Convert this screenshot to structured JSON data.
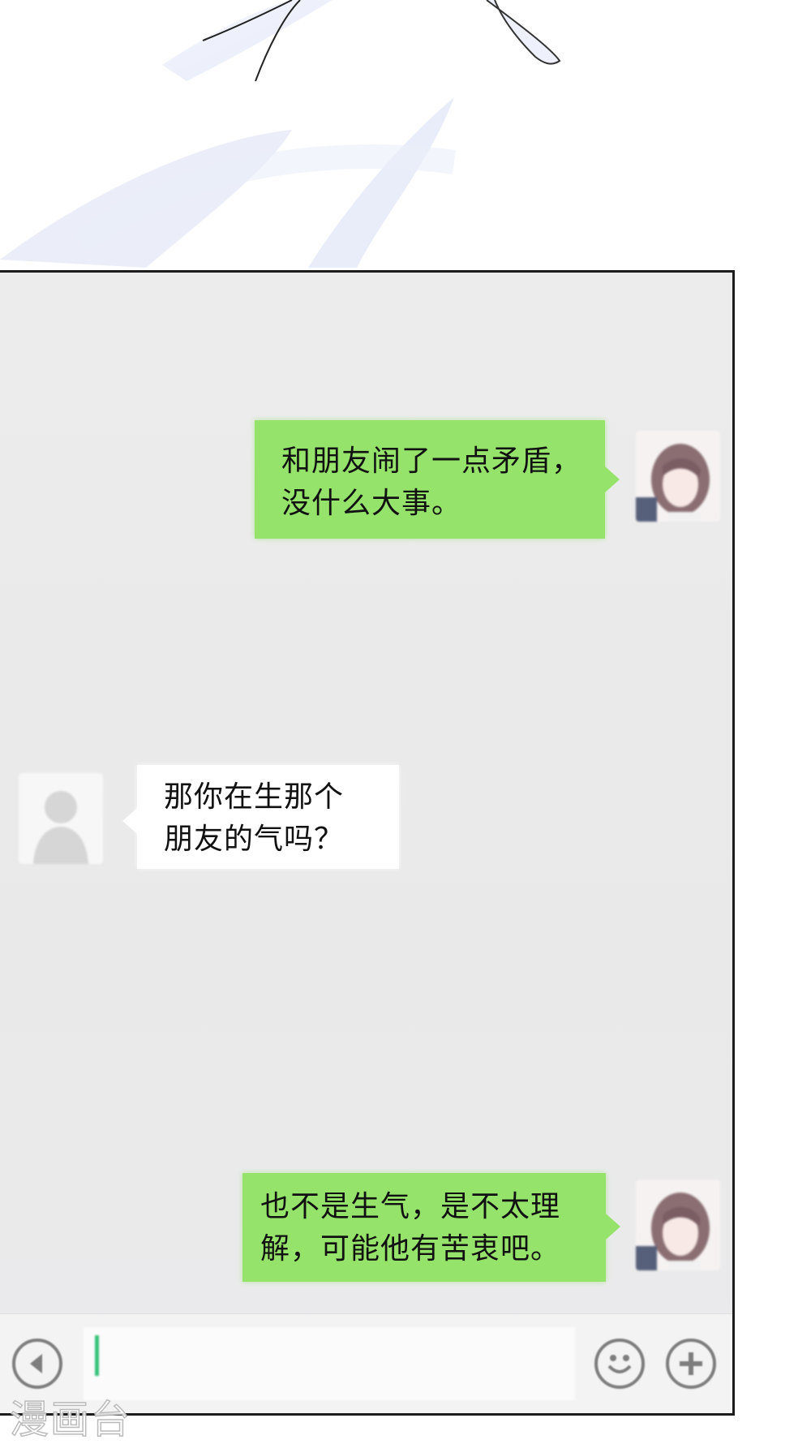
{
  "chat": {
    "messages": [
      {
        "side": "right",
        "lines": [
          "和朋友闹了一点矛盾，",
          "没什么大事。"
        ]
      },
      {
        "side": "left",
        "lines": [
          "那你在生那个",
          "朋友的气吗？"
        ]
      },
      {
        "side": "right",
        "lines": [
          "也不是生气，是不太理",
          "解，可能他有苦衷吧。"
        ]
      }
    ]
  },
  "input_bar": {
    "icons": [
      "voice-icon",
      "emoji-icon",
      "plus-icon"
    ],
    "accent_color": "#37c179"
  },
  "colors": {
    "bubble_green": "#95e36a",
    "chat_background": "#ececec"
  },
  "watermark": {
    "text": "漫画台"
  }
}
